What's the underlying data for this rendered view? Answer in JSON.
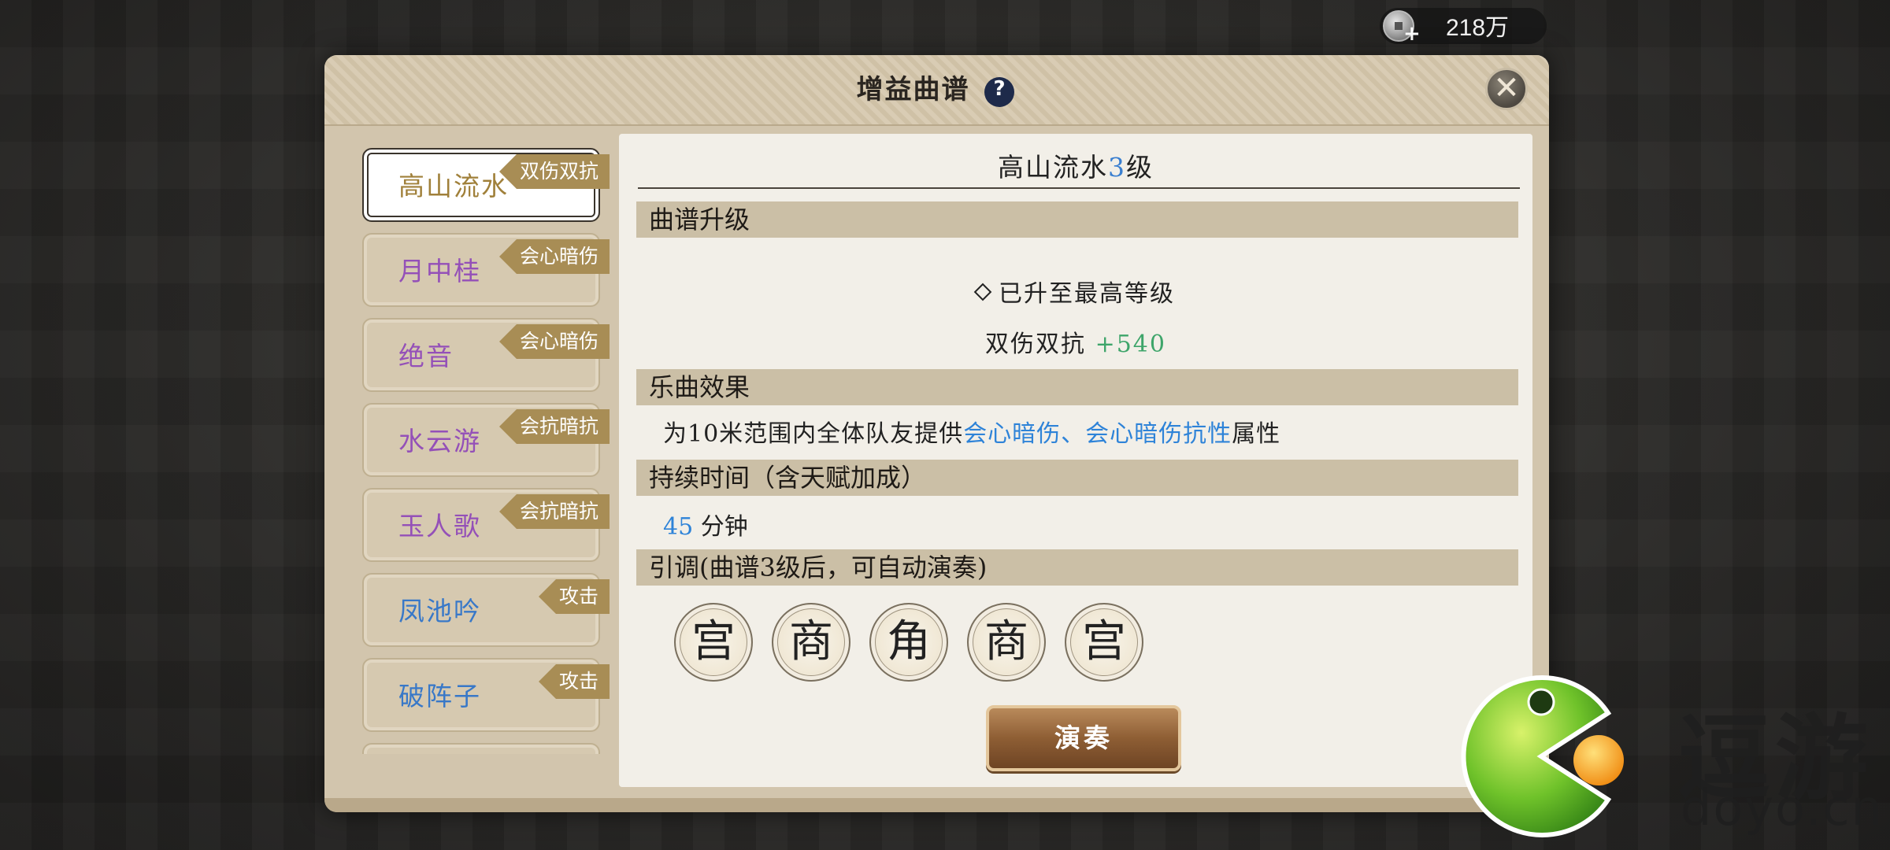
{
  "currency": {
    "icon": "coin-add-icon",
    "amount": "218万"
  },
  "dialog": {
    "title": "增益曲谱",
    "help_icon": "question-icon",
    "close_icon": "close-icon"
  },
  "songs": [
    {
      "name": "高山流水",
      "tag": "双伤双抗",
      "color": "#a0803a",
      "active": true
    },
    {
      "name": "月中桂",
      "tag": "会心暗伤",
      "color": "#9450b8"
    },
    {
      "name": "绝音",
      "tag": "会心暗伤",
      "color": "#9450b8"
    },
    {
      "name": "水云游",
      "tag": "会抗暗抗",
      "color": "#9450b8"
    },
    {
      "name": "玉人歌",
      "tag": "会抗暗抗",
      "color": "#9450b8"
    },
    {
      "name": "凤池吟",
      "tag": "攻击",
      "color": "#3878c8"
    },
    {
      "name": "破阵子",
      "tag": "攻击",
      "color": "#3878c8"
    }
  ],
  "detail": {
    "title_name": "高山流水",
    "title_level": "3",
    "title_suffix": "级",
    "upgrade": {
      "header": "曲谱升级",
      "max_text": "已升至最高等级",
      "bonus_label": "双伤双抗",
      "bonus_value": "+540"
    },
    "effect": {
      "header": "乐曲效果",
      "prefix": "为10米范围内全体队友提供",
      "highlight": "会心暗伤、会心暗伤抗性",
      "suffix": "属性"
    },
    "duration": {
      "header": "持续时间（含天赋加成）",
      "value": "45",
      "unit": "分钟"
    },
    "tune": {
      "header": "引调(曲谱3级后，可自动演奏)",
      "notes": [
        "宫",
        "商",
        "角",
        "商",
        "宫"
      ]
    },
    "play_button": "演奏"
  },
  "watermark": {
    "text": "逗游",
    "domain": "doyo.cn"
  }
}
